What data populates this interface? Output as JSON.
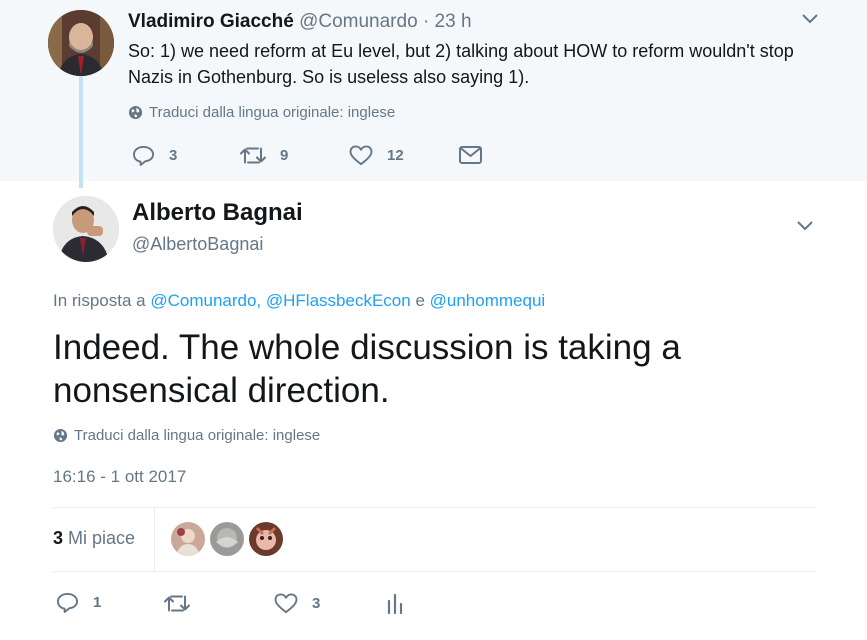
{
  "parent_tweet": {
    "author_name": "Vladimiro Giacché",
    "author_handle": "@Comunardo",
    "separator": "·",
    "time": "23 h",
    "text": "So: 1) we need reform at Eu level, but 2) talking about HOW to reform wouldn't stop Nazis in Gothenburg. So is useless also saying 1).",
    "translate_label": "Traduci dalla lingua originale: inglese",
    "replies": "3",
    "retweets": "9",
    "likes": "12"
  },
  "main_tweet": {
    "author_name": "Alberto Bagnai",
    "author_handle": "@AlbertoBagnai",
    "reply_prefix": "In risposta a",
    "reply_users": [
      "@Comunardo,",
      "@HFlassbeckEcon",
      "@unhommequi"
    ],
    "reply_conj": "e",
    "text": "Indeed. The whole discussion is taking a nonsensical direction.",
    "translate_label": "Traduci dalla lingua originale: inglese",
    "timestamp": "16:16 - 1 ott 2017",
    "like_count": "3",
    "like_label": "Mi piace",
    "replies": "1",
    "retweets": "",
    "likes": "3"
  },
  "colors": {
    "text_primary": "#14171a",
    "text_secondary": "#657786",
    "link": "#1da1f2",
    "parent_bg": "#f5f8fa",
    "thread_line": "#c4e1f5"
  },
  "icons": [
    "globe-icon",
    "reply-icon",
    "retweet-icon",
    "like-icon",
    "dm-icon",
    "chevron-down-icon",
    "analytics-icon"
  ]
}
